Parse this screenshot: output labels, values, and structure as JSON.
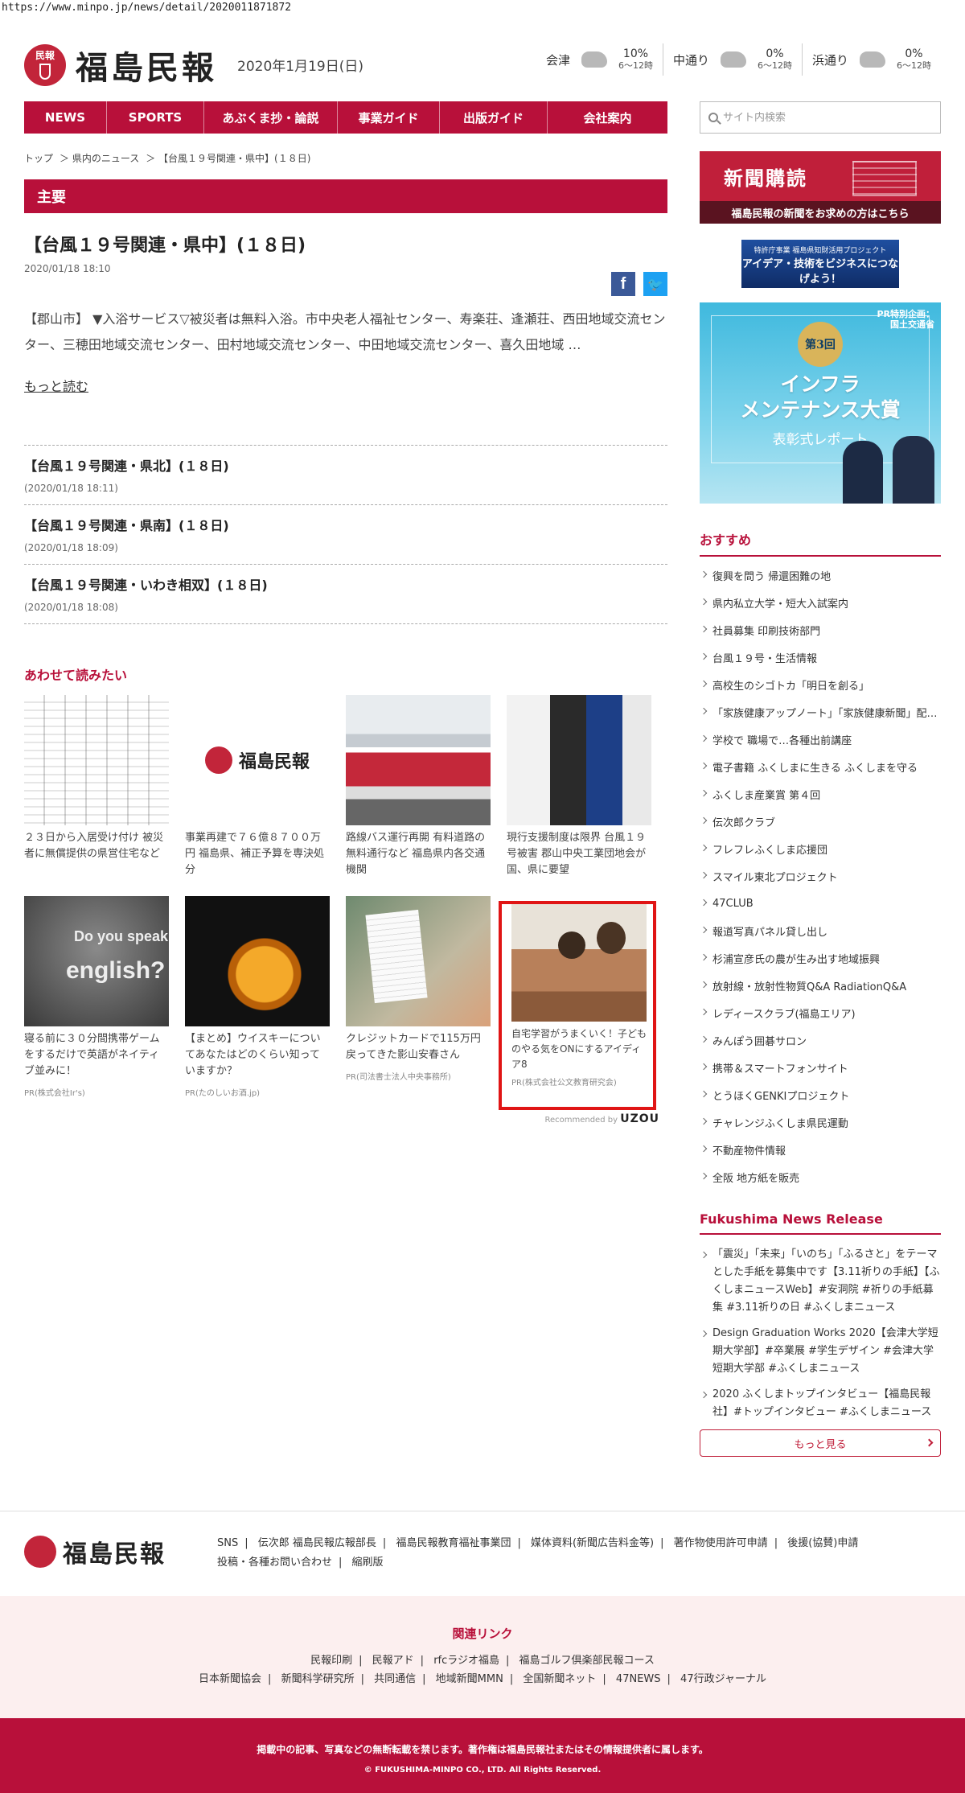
{
  "url": "https://www.minpo.jp/news/detail/2020011871872",
  "header": {
    "logo_seal": "民報",
    "logo_text": "福島民報",
    "date": "2020年1月19日(日)",
    "weather": [
      {
        "name": "会津",
        "pct": "10%",
        "time": "6〜12時",
        "icon": "cloud-icon"
      },
      {
        "name": "中通り",
        "pct": "0%",
        "time": "6〜12時",
        "icon": "sun-cloud-icon"
      },
      {
        "name": "浜通り",
        "pct": "0%",
        "time": "6〜12時",
        "icon": "sun-cloud-icon"
      }
    ]
  },
  "nav": [
    "NEWS",
    "SPORTS",
    "あぶくま抄・論説",
    "事業ガイド",
    "出版ガイド",
    "会社案内"
  ],
  "search": {
    "placeholder": "サイト内検索"
  },
  "breadcrumb": [
    "トップ",
    "＞ 県内のニュース",
    "＞ 【台風１９号関連・県中】(１８日)"
  ],
  "section": "主要",
  "article": {
    "title": "【台風１９号関連・県中】(１８日)",
    "date": "2020/01/18 18:10",
    "body": "【郡山市】 ▼入浴サービス▽被災者は無料入浴。市中央老人福祉センター、寿楽荘、逢瀬荘、西田地域交流センター、三穂田地域交流センター、田村地域交流センター、中田地域交流センター、喜久田地域 …",
    "more": "もっと読む"
  },
  "related": [
    {
      "title": "【台風１９号関連・県北】(１８日)",
      "date": "(2020/01/18 18:11)"
    },
    {
      "title": "【台風１９号関連・県南】(１８日)",
      "date": "(2020/01/18 18:09)"
    },
    {
      "title": "【台風１９号関連・いわき相双】(１８日)",
      "date": "(2020/01/18 18:08)"
    }
  ],
  "also_read": {
    "heading": "あわせて読みたい",
    "cards": [
      {
        "title": "２３日から入居受け付け 被災者に無償提供の県営住宅など",
        "pr": ""
      },
      {
        "title": "事業再建で７６億８７００万円 福島県、補正予算を専決処分",
        "pr": "",
        "logo": "福島民報"
      },
      {
        "title": "路線バス運行再開 有料道路の無料通行など 福島県内各交通機関",
        "pr": ""
      },
      {
        "title": "現行支援制度は限界 台風１９号被害 郡山中央工業団地会が国、県に要望",
        "pr": ""
      },
      {
        "title": "寝る前に３０分間携帯ゲームをするだけで英語がネイティブ並みに！",
        "pr": "PR(株式会社Ir's)",
        "img_text1": "Do you speak",
        "img_text2": "english?"
      },
      {
        "title": "【まとめ】ウイスキーについてあなたはどのくらい知っていますか？",
        "pr": "PR(たのしいお酒.jp)"
      },
      {
        "title": "クレジットカードで115万円戻ってきた影山安春さん",
        "pr": "PR(司法書士法人中央事務所)"
      },
      {
        "title": "自宅学習がうまくいく！子どものやる気をONにするアイディア8",
        "pr": "PR(株式会社公文教育研究会)"
      }
    ],
    "recommended_prefix": "Recommended by",
    "recommended_brand": "UZOU"
  },
  "sidebar": {
    "subscribe_title": "新聞購読",
    "subscribe_sub": "福島民報の新聞をお求めの方はこちら",
    "idea_small": "特許庁事業 福島県知財活用プロジェクト",
    "idea_main": "アイデア・技術をビジネスにつなげよう！",
    "infra_pr": "PR特別企画：\n国土交通省",
    "infra_badge": "第3回",
    "infra_title": "インフラ\nメンテナンス大賞",
    "infra_sub": "表彰式レポート",
    "recommend_heading": "おすすめ",
    "recommend": [
      "復興を問う 帰還困難の地",
      "県内私立大学・短大入試案内",
      "社員募集 印刷技術部門",
      "台風１９号・生活情報",
      "高校生のシゴトカ「明日を創る」",
      "「家族健康アップノート」「家族健康新聞」配…",
      "学校で 職場で…各種出前講座",
      "電子書籍 ふくしまに生きる ふくしまを守る",
      "ふくしま産業賞 第４回",
      "伝次郎クラブ",
      "フレフレふくしま応援団",
      "スマイル東北プロジェクト",
      "47CLUB",
      "報道写真パネル貸し出し",
      "杉浦宣彦氏の農が生み出す地域振興",
      "放射線・放射性物質Q&A RadiationQ&A",
      "レディースクラブ(福島エリア)",
      "みんぽう囲碁サロン",
      "携帯＆スマートフォンサイト",
      "とうほくGENKIプロジェクト",
      "チャレンジふくしま県民運動",
      "不動産物件情報",
      "全阪 地方紙を販売"
    ],
    "release_heading": "Fukushima News Release",
    "releases": [
      "「震災」「未来」「いのち」「ふるさと」をテーマとした手紙を募集中です【3.11祈りの手紙】【ふくしまニュースWeb】#安洞院 #祈りの手紙募集 #3.11祈りの日 #ふくしまニュース",
      "Design Graduation Works 2020【会津大学短期大学部】#卒業展 #学生デザイン #会津大学短期大学部 #ふくしまニュース",
      "2020 ふくしまトップインタビュー【福島民報社】#トップインタビュー #ふくしまニュース"
    ],
    "more_btn": "もっと見る"
  },
  "footer": {
    "logo": "福島民報",
    "links": [
      "SNS",
      "伝次郎 福島民報広報部長",
      "福島民報教育福祉事業団",
      "媒体資料(新聞広告料金等)",
      "著作物使用許可申請",
      "後援(協賛)申請",
      "投稿・各種お問い合わせ",
      "縮刷版"
    ],
    "related_heading": "関連リンク",
    "related_row1": [
      "民報印刷",
      "民報アド",
      "rfcラジオ福島",
      "福島ゴルフ倶楽部民報コース"
    ],
    "related_row2": [
      "日本新聞協会",
      "新聞科学研究所",
      "共同通信",
      "地域新聞MMN",
      "全国新聞ネット",
      "47NEWS",
      "47行政ジャーナル"
    ],
    "notice": "掲載中の記事、写真などの無断転載を禁じます。著作権は福島民報社またはその情報提供者に属します。",
    "copyright": "© FUKUSHIMA-MINPO CO., LTD. All Rights Reserved."
  }
}
